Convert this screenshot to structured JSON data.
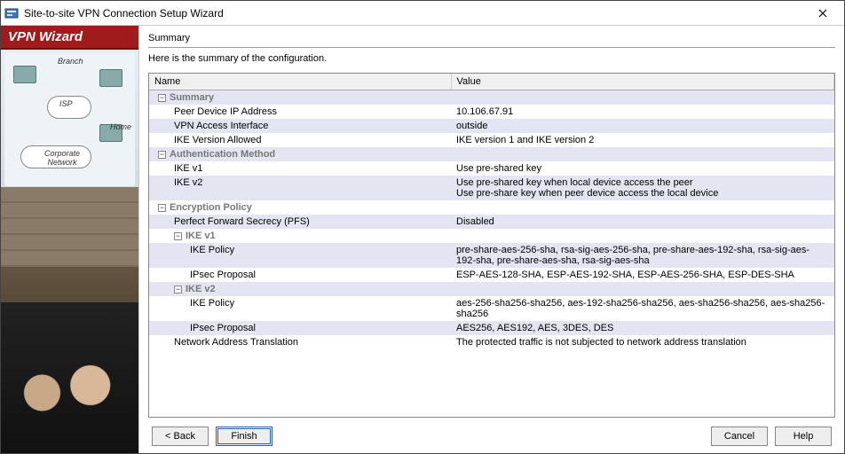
{
  "window": {
    "title": "Site-to-site VPN Connection Setup Wizard"
  },
  "sidebar": {
    "banner": "VPN Wizard",
    "diagram_labels": [
      "Branch",
      "ISP",
      "Home",
      "Corporate Network"
    ]
  },
  "content": {
    "section_title": "Summary",
    "section_desc": "Here is the summary of the configuration."
  },
  "table": {
    "col_name": "Name",
    "col_value": "Value"
  },
  "rows": {
    "g_summary": "Summary",
    "peer_ip_n": "Peer Device IP Address",
    "peer_ip_v": "10.106.67.91",
    "vpn_if_n": "VPN Access Interface",
    "vpn_if_v": "outside",
    "ike_ver_n": "IKE Version Allowed",
    "ike_ver_v": "IKE version 1 and IKE version 2",
    "g_auth": "Authentication Method",
    "auth_v1_n": "IKE v1",
    "auth_v1_v": "Use pre-shared key",
    "auth_v2_n": "IKE v2",
    "auth_v2_v": "Use pre-shared key when local device access the peer\nUse pre-share key when peer device access the local device",
    "g_enc": "Encryption Policy",
    "pfs_n": "Perfect Forward Secrecy (PFS)",
    "pfs_v": "Disabled",
    "g_ikev1": "IKE v1",
    "ikev1_pol_n": "IKE Policy",
    "ikev1_pol_v": "pre-share-aes-256-sha, rsa-sig-aes-256-sha, pre-share-aes-192-sha, rsa-sig-aes-192-sha, pre-share-aes-sha, rsa-sig-aes-sha",
    "ikev1_ipsec_n": "IPsec Proposal",
    "ikev1_ipsec_v": "ESP-AES-128-SHA, ESP-AES-192-SHA, ESP-AES-256-SHA, ESP-DES-SHA",
    "g_ikev2": "IKE v2",
    "ikev2_pol_n": "IKE Policy",
    "ikev2_pol_v": "aes-256-sha256-sha256, aes-192-sha256-sha256, aes-sha256-sha256, aes-sha256-sha256",
    "ikev2_ipsec_n": "IPsec Proposal",
    "ikev2_ipsec_v": "AES256, AES192, AES, 3DES, DES",
    "nat_n": "Network Address Translation",
    "nat_v": "The protected traffic is not subjected to network address translation"
  },
  "buttons": {
    "back": "< Back",
    "finish": "Finish",
    "cancel": "Cancel",
    "help": "Help"
  }
}
